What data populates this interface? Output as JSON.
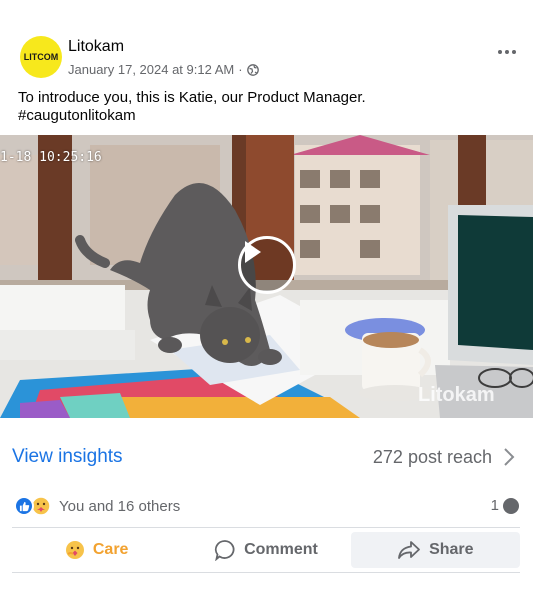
{
  "post": {
    "page_name": "Litokam",
    "avatar_text": "LITCOM",
    "avatar_color": "#f7e81c",
    "date": "January 17, 2024 at 9:12 AM",
    "separator": "·",
    "caption_line1": "To introduce you, this is Katie, our Product Manager.",
    "caption_line2": "#caugutonlitokam"
  },
  "media": {
    "timestamp": "1-18  10:25:16",
    "watermark": "Litokam",
    "play_icon": "play-icon"
  },
  "insights": {
    "view_label": "View insights",
    "reach_text": "272 post reach",
    "link_color": "#1b74e4"
  },
  "reactions": {
    "summary": "You and 16 others",
    "comment_count": "1",
    "icons": [
      "like-icon",
      "care-icon"
    ]
  },
  "actions": {
    "care_label": "Care",
    "comment_label": "Comment",
    "share_label": "Share",
    "care_color": "#f2a230"
  }
}
